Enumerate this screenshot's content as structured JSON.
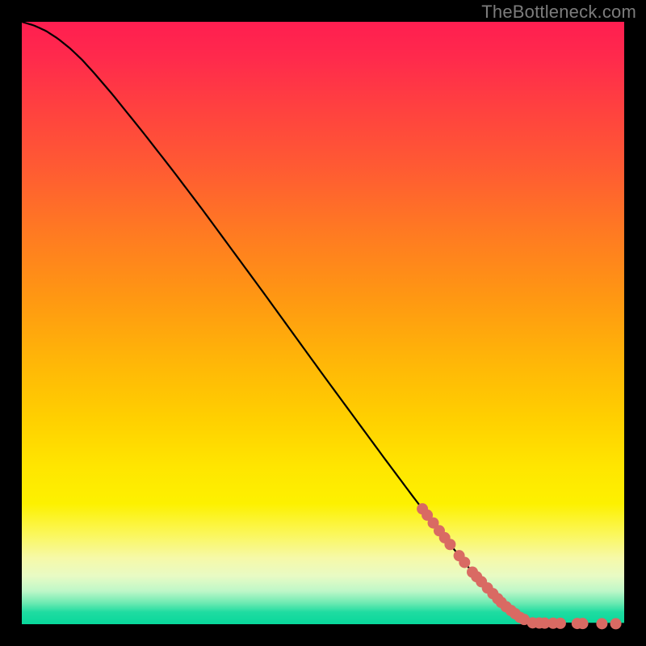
{
  "watermark": "TheBottleneck.com",
  "colors": {
    "frame": "#000000",
    "point": "#d96a63",
    "curve": "#000000"
  },
  "chart_data": {
    "type": "line",
    "title": "",
    "xlabel": "",
    "ylabel": "",
    "xlim": [
      0,
      100
    ],
    "ylim": [
      0,
      100
    ],
    "grid": false,
    "curve": [
      {
        "x": 0.0,
        "y": 100.0
      },
      {
        "x": 2.0,
        "y": 99.4
      },
      {
        "x": 4.0,
        "y": 98.5
      },
      {
        "x": 6.0,
        "y": 97.2
      },
      {
        "x": 8.0,
        "y": 95.6
      },
      {
        "x": 10.0,
        "y": 93.7
      },
      {
        "x": 12.0,
        "y": 91.5
      },
      {
        "x": 15.0,
        "y": 88.0
      },
      {
        "x": 20.0,
        "y": 81.8
      },
      {
        "x": 25.0,
        "y": 75.4
      },
      {
        "x": 30.0,
        "y": 68.8
      },
      {
        "x": 35.0,
        "y": 62.0
      },
      {
        "x": 40.0,
        "y": 55.2
      },
      {
        "x": 45.0,
        "y": 48.3
      },
      {
        "x": 50.0,
        "y": 41.4
      },
      {
        "x": 55.0,
        "y": 34.6
      },
      {
        "x": 60.0,
        "y": 27.8
      },
      {
        "x": 65.0,
        "y": 21.1
      },
      {
        "x": 70.0,
        "y": 14.6
      },
      {
        "x": 75.0,
        "y": 8.4
      },
      {
        "x": 80.0,
        "y": 3.2
      },
      {
        "x": 83.0,
        "y": 0.9
      },
      {
        "x": 85.0,
        "y": 0.3
      },
      {
        "x": 88.0,
        "y": 0.15
      },
      {
        "x": 92.0,
        "y": 0.1
      },
      {
        "x": 96.0,
        "y": 0.08
      },
      {
        "x": 100.0,
        "y": 0.07
      }
    ],
    "points_on_curve_x": [
      66.5,
      67.3,
      68.3,
      69.3,
      70.2,
      71.1,
      72.6,
      73.5,
      74.8,
      75.5,
      76.3,
      77.3,
      78.2,
      79.0,
      79.6,
      80.4,
      81.2,
      81.9,
      82.7,
      83.4
    ],
    "points_flat": [
      {
        "x": 84.8,
        "y": 0.22
      },
      {
        "x": 85.9,
        "y": 0.2
      },
      {
        "x": 86.8,
        "y": 0.18
      },
      {
        "x": 88.2,
        "y": 0.16
      },
      {
        "x": 89.4,
        "y": 0.15
      },
      {
        "x": 92.2,
        "y": 0.12
      },
      {
        "x": 93.1,
        "y": 0.11
      },
      {
        "x": 96.3,
        "y": 0.09
      },
      {
        "x": 98.6,
        "y": 0.08
      }
    ],
    "point_radius": 7
  }
}
